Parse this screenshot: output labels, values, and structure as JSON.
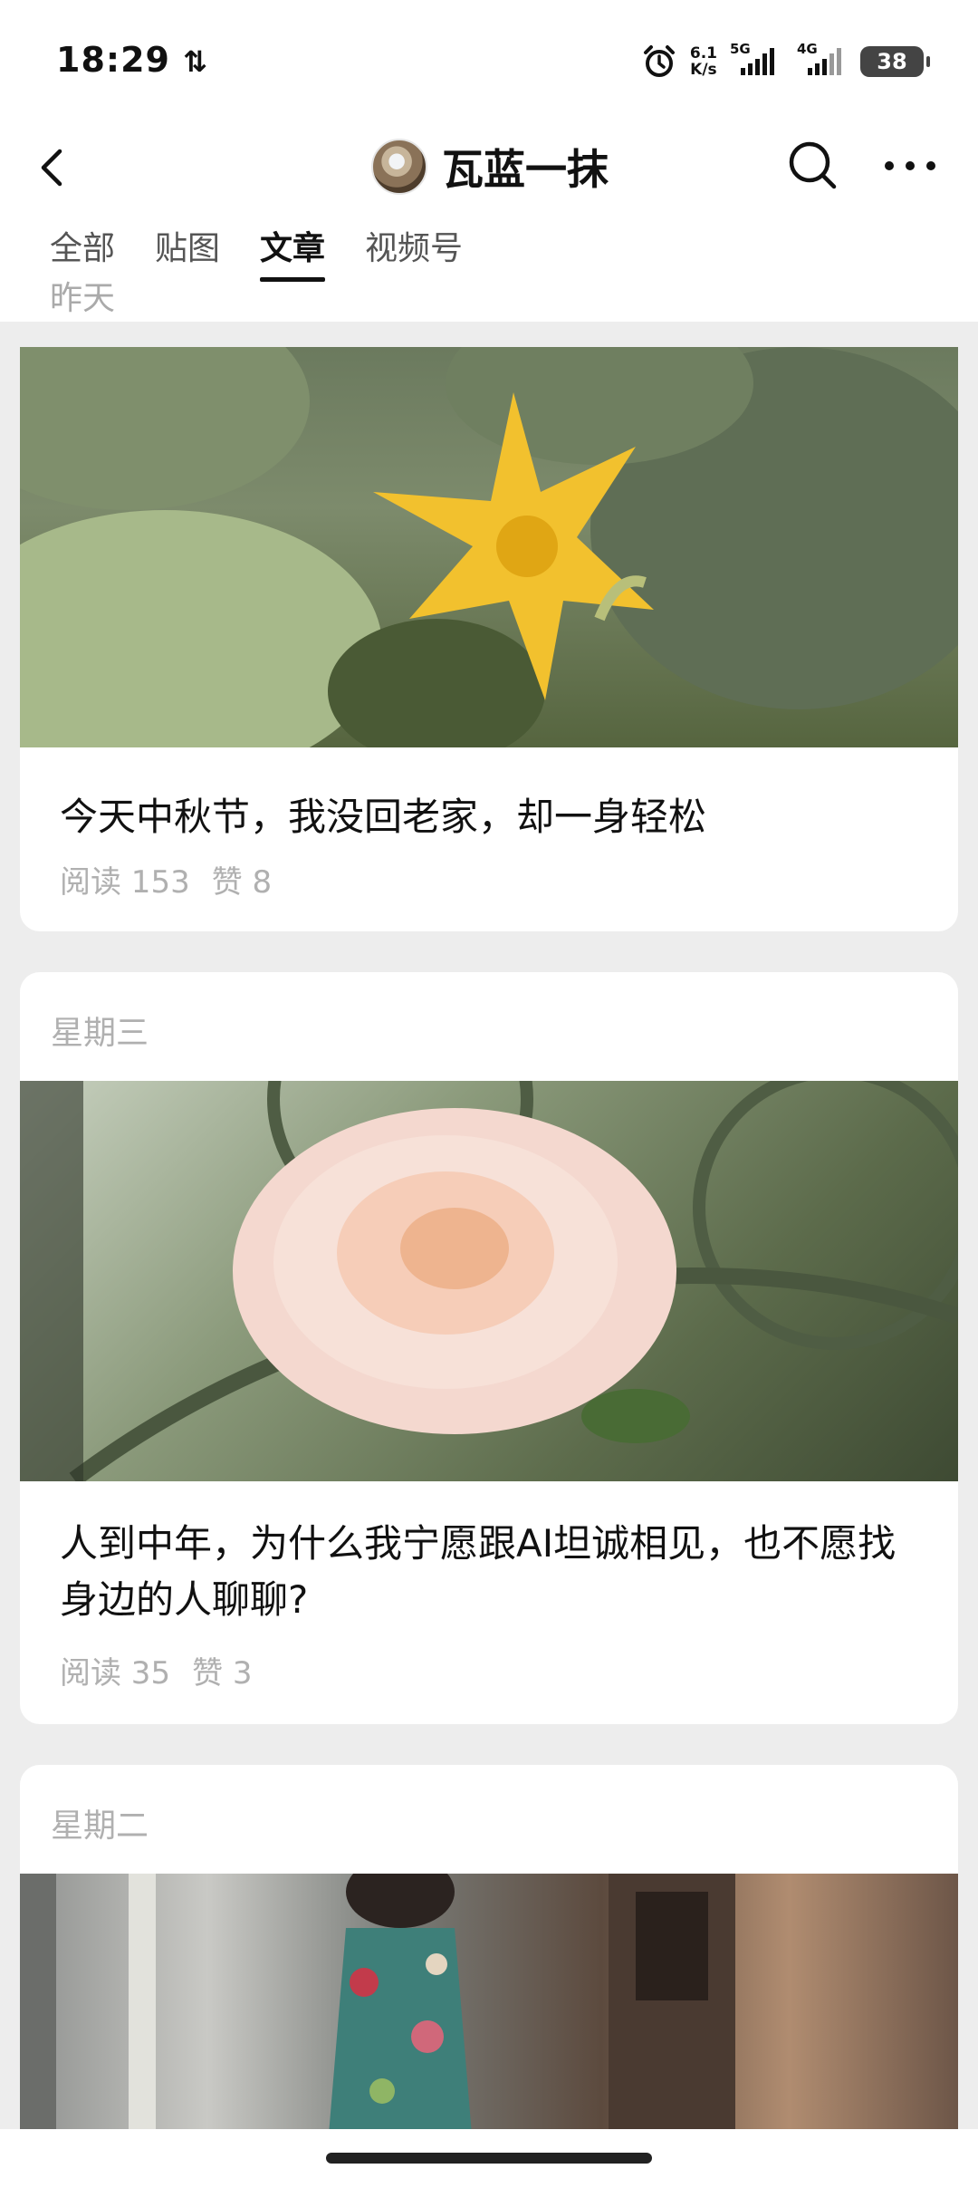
{
  "status_bar": {
    "time": "18:29",
    "data_arrows": "⇅",
    "net_speed_value": "6.1",
    "net_speed_unit": "K/s",
    "signal_1_tag": "5G",
    "signal_2_tag": "4G",
    "battery": "38"
  },
  "header": {
    "title": "瓦蓝一抹",
    "back_icon": "chevron-left-icon",
    "search_icon": "search-icon",
    "more_icon": "more-horizontal-icon"
  },
  "tabs": [
    {
      "label": "全部",
      "active": false
    },
    {
      "label": "贴图",
      "active": false
    },
    {
      "label": "文章",
      "active": true
    },
    {
      "label": "视频号",
      "active": false
    }
  ],
  "sticky_date": "昨天",
  "articles": [
    {
      "date": "",
      "title": "今天中秋节，我没回老家，却一身轻松",
      "reads": "阅读 153",
      "likes": "赞 8"
    },
    {
      "date": "星期三",
      "title": "人到中年，为什么我宁愿跟AI坦诚相见，也不愿找身边的人聊聊?",
      "reads": "阅读 35",
      "likes": "赞 3"
    },
    {
      "date": "星期二",
      "title": "",
      "reads": "",
      "likes": ""
    }
  ]
}
